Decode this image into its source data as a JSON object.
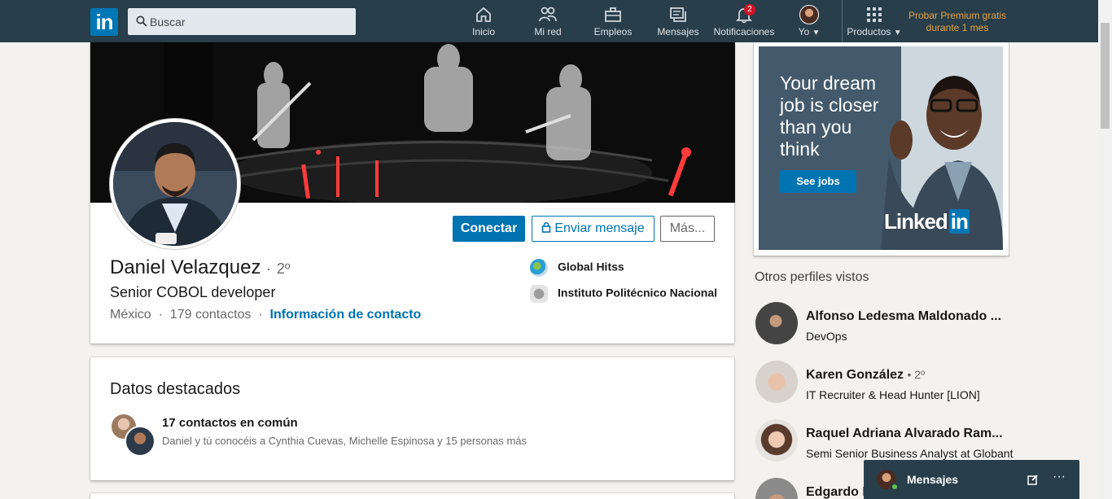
{
  "nav": {
    "logo_text": "in",
    "search_placeholder": "Buscar",
    "items": [
      {
        "label": "Inicio",
        "icon": "home-icon"
      },
      {
        "label": "Mi red",
        "icon": "network-icon"
      },
      {
        "label": "Empleos",
        "icon": "briefcase-icon"
      },
      {
        "label": "Mensajes",
        "icon": "messages-icon"
      },
      {
        "label": "Notificaciones",
        "icon": "bell-icon",
        "badge": "2"
      },
      {
        "label": "Yo",
        "icon": "avatar"
      },
      {
        "label": "Productos",
        "icon": "grid-icon"
      }
    ],
    "premium_line1": "Probar Premium gratis",
    "premium_line2": "durante 1 mes"
  },
  "profile": {
    "name": "Daniel Velazquez",
    "degree_sep": "·",
    "degree": "2º",
    "headline": "Senior COBOL developer",
    "location": "México",
    "dot": "·",
    "connections": "179 contactos",
    "contact_info": "Información de contacto",
    "buttons": {
      "connect": "Conectar",
      "message": "Enviar mensaje",
      "more": "Más..."
    },
    "orgs": [
      "Global Hitss",
      "Instituto Politécnico Nacional"
    ]
  },
  "highlights": {
    "title": "Datos destacados",
    "item_title": "17 contactos en común",
    "item_sub": "Daniel y tú conocéis a Cynthia Cuevas, Michelle Espinosa y 15 personas más"
  },
  "ad": {
    "text": "Your dream job is closer than you think",
    "button": "See jobs",
    "brand": "Linked",
    "brand_in": "in"
  },
  "rail": {
    "title": "Otros perfiles vistos",
    "people": [
      {
        "name": "Alfonso Ledesma Maldonado ...",
        "degree": "",
        "headline": "DevOps"
      },
      {
        "name": "Karen González",
        "degree": "• 2º",
        "headline": "IT Recruiter & Head Hunter [LION]"
      },
      {
        "name": "Raquel Adriana Alvarado Ram...",
        "degree": "",
        "headline": "Semi Senior Business Analyst at Globant"
      },
      {
        "name": "Edgardo M",
        "degree": "",
        "headline": ""
      }
    ]
  },
  "messaging": {
    "title": "Mensajes",
    "compose_icon": "compose-icon",
    "more": "···"
  }
}
